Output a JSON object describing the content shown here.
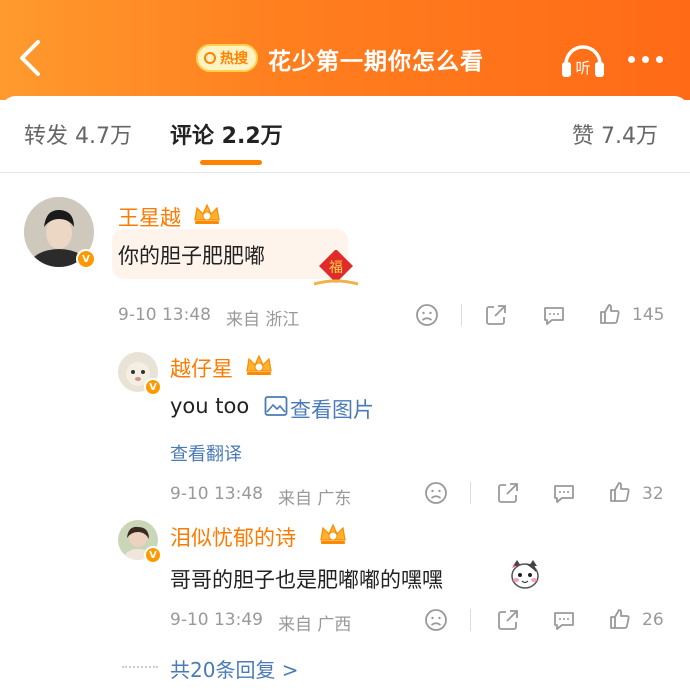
{
  "header": {
    "hot_badge": "热搜",
    "title": "花少第一期你怎么看",
    "listen_label": "听"
  },
  "tabs": {
    "repost": "转发 4.7万",
    "comment": "评论 2.2万",
    "like": "赞 7.4万"
  },
  "comments": [
    {
      "user": "王星越",
      "text": "你的胆子肥肥嘟",
      "time": "9-10 13:48",
      "location": "来自 浙江",
      "likes": "145",
      "sticker_text": "福"
    }
  ],
  "replies": [
    {
      "user": "越仔星",
      "text": "you too",
      "image_link": "查看图片",
      "translate": "查看翻译",
      "time": "9-10 13:48",
      "location": "来自 广东",
      "likes": "32"
    },
    {
      "user": "泪似忧郁的诗",
      "text": "哥哥的胆子也是肥嘟嘟的嘿嘿",
      "time": "9-10 13:49",
      "location": "来自 广西",
      "likes": "26"
    }
  ],
  "more_replies": "共20条回复 >",
  "colors": {
    "accent": "#ff8200",
    "username": "#ff7a00",
    "link": "#4a7bb7"
  }
}
